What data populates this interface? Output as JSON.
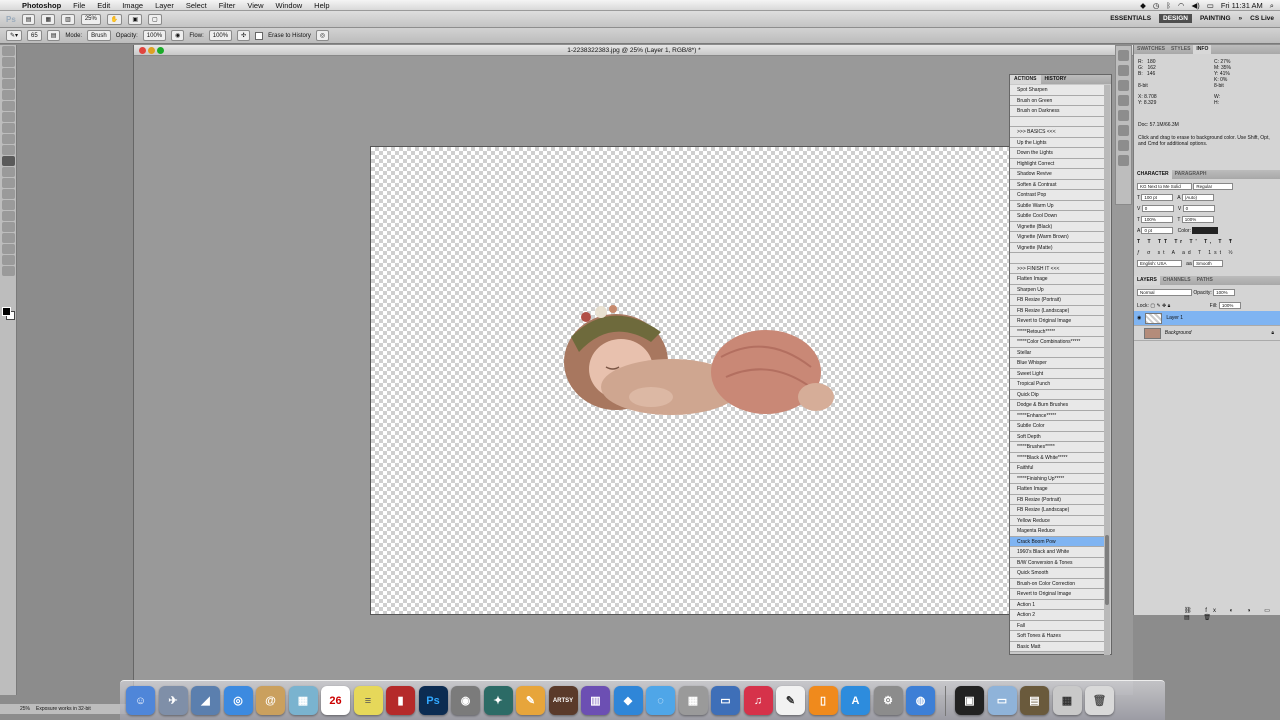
{
  "menubar": {
    "app_name": "Photoshop",
    "items": [
      "File",
      "Edit",
      "Image",
      "Layer",
      "Select",
      "Filter",
      "View",
      "Window",
      "Help"
    ],
    "clock": "Fri 11:31 AM"
  },
  "appbar": {
    "logo": "Ps",
    "zoom": "25%",
    "workspaces": [
      "ESSENTIALS",
      "DESIGN",
      "PAINTING"
    ],
    "active_workspace": "DESIGN",
    "cslive": "CS Live"
  },
  "options": {
    "brush_size": "65",
    "mode_label": "Mode:",
    "mode_value": "Brush",
    "opacity_label": "Opacity:",
    "opacity_value": "100%",
    "flow_label": "Flow:",
    "flow_value": "100%",
    "erase_history": "Erase to History"
  },
  "document": {
    "title": "1-2238322383.jpg @ 25% (Layer 1, RGB/8*) *"
  },
  "actions_panel": {
    "tabs": [
      "ACTIONS",
      "HISTORY"
    ],
    "active_tab": "ACTIONS",
    "items": [
      "Spot Sharpen",
      "Brush on Green",
      "Brush on Darkness",
      "",
      ">>> BASICS <<<",
      "Up the Lights",
      "Down the Lights",
      "Highlight Correct",
      "Shadow Revive",
      "Soften & Contrast",
      "Contrast Pop",
      "Subtle Warm Up",
      "Subtle Cool Down",
      "Vignette (Black)",
      "Vignette (Warm Brown)",
      "Vignette (Matte)",
      "",
      ">>> FINISH IT <<<",
      "Flatten Image",
      "Sharpen Up",
      "FB Resize (Portrait)",
      "FB Resize (Landscape)",
      "Revert to Original Image",
      "*****Retouch*****",
      "*****Color Combinations*****",
      "Stellar",
      "Blue Whisper",
      "Sweet Light",
      "Tropical Punch",
      "Quick Dip",
      "Dodge & Burn Brushes",
      "*****Enhance*****",
      "Subtle Color",
      "Soft Depth",
      "*****Brushes*****",
      "*****Black & White*****",
      "Faithful",
      "*****Finishing Up*****",
      "Flatten Image",
      "FB Resize (Portrait)",
      "FB Resize (Landscape)",
      "Yellow Reduce",
      "Magenta Reduce",
      "Crack Boom Pow",
      "1960's Black and White",
      "B/W Conversion & Tones",
      "Quick Smooth",
      "Brush-on Color Correction",
      "Revert to Original Image",
      "Action 1",
      "Action 2",
      "Fall",
      "Soft Tones & Hazes",
      "Basic Matt"
    ],
    "selected": "Crack Boom Pow"
  },
  "info_panel": {
    "tabs": [
      "SWATCHES",
      "STYLES",
      "INFO"
    ],
    "active_tab": "INFO",
    "rgb": {
      "r": "180",
      "g": "162",
      "b": "146"
    },
    "cmyk": {
      "c": "27%",
      "m": "35%",
      "y": "41%",
      "k": "0%"
    },
    "bit_left": "8-bit",
    "bit_right": "8-bit",
    "x": "8.708",
    "y": "8.329",
    "doc": "Doc: 57.1M/66.3M",
    "hint": "Click and drag to erase to background color. Use Shift, Opt, and Cmd for additional options."
  },
  "character_panel": {
    "tabs": [
      "CHARACTER",
      "PARAGRAPH"
    ],
    "font": "KG Next to Me Solid",
    "style": "Regular",
    "size": "100 pt",
    "leading": "(Auto)",
    "kerning": "0",
    "tracking": "0",
    "vscale": "100%",
    "hscale": "100%",
    "baseline": "0 pt",
    "color_label": "Color:",
    "language": "English: USA",
    "aa": "Smooth"
  },
  "layers_panel": {
    "tabs": [
      "LAYERS",
      "CHANNELS",
      "PATHS"
    ],
    "blend": "Normal",
    "opacity_label": "Opacity:",
    "opacity": "100%",
    "lock_label": "Lock:",
    "fill_label": "Fill:",
    "fill": "100%",
    "layers": [
      {
        "name": "Layer 1",
        "selected": true
      },
      {
        "name": "Background",
        "selected": false
      }
    ]
  },
  "status": {
    "zoom": "25%",
    "text": "Exposure works in 32-bit"
  },
  "dock": {
    "calendar_day": "26",
    "icons": [
      "finder-icon",
      "launchpad-icon",
      "preview-icon",
      "safari-icon",
      "contacts-icon",
      "image-capture-icon",
      "calendar-icon",
      "stickies-icon",
      "photobooth-icon",
      "photoshop-icon",
      "bridge-icon",
      "camera-raw-icon",
      "pages-icon",
      "artisy-icon",
      "charts-icon",
      "dropbox-icon",
      "messages-icon",
      "calculator-icon",
      "keynote-icon",
      "itunes-icon",
      "pencil-icon",
      "ibooks-icon",
      "app-store-icon",
      "system-prefs-icon",
      "chrome-icon",
      "terminal-icon",
      "folder-icon",
      "stack-icon",
      "downloads-icon",
      "trash-icon"
    ]
  }
}
